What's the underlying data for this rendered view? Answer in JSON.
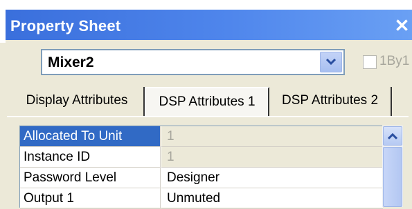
{
  "window": {
    "title": "Property Sheet",
    "close_glyph": "✕"
  },
  "selector": {
    "value": "Mixer2",
    "checkbox_label": "1By1",
    "checkbox_checked": false
  },
  "tabs": [
    {
      "label": "Display Attributes"
    },
    {
      "label": "DSP Attributes 1",
      "active": true
    },
    {
      "label": "DSP Attributes 2"
    }
  ],
  "properties": [
    {
      "name": "Allocated To Unit",
      "value": "1",
      "selected": true,
      "readonly": true
    },
    {
      "name": "Instance ID",
      "value": "1",
      "readonly": true
    },
    {
      "name": "Password Level",
      "value": "Designer"
    },
    {
      "name": "Output 1",
      "value": "Unmuted"
    }
  ],
  "colors": {
    "titlebar": "#3a6fdc",
    "selection": "#316ac5",
    "panel": "#ece9d8"
  },
  "icons": {
    "close": "close-icon",
    "dropdown": "chevron-down-icon",
    "scroll_up": "chevron-up-icon"
  }
}
